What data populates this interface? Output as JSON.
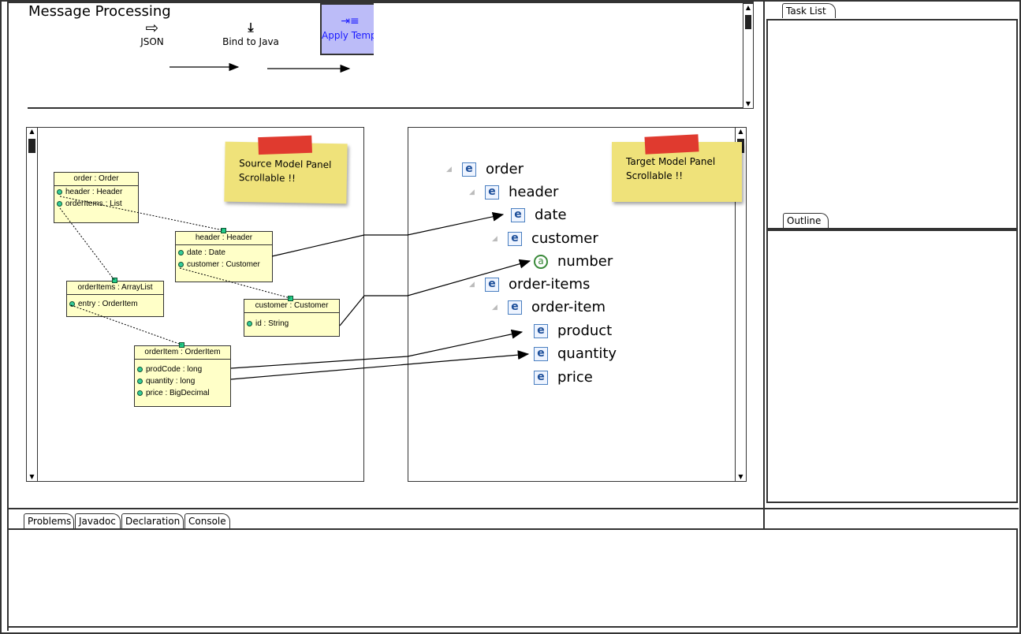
{
  "title": "Message Processing",
  "toolbar": {
    "steps": [
      {
        "label": "JSON",
        "icon": "arrow-right-outline-icon"
      },
      {
        "label": "Bind to Java",
        "icon": "download-icon"
      },
      {
        "label": "Apply Temp",
        "icon": "template-icon",
        "active": true
      }
    ],
    "active_color": "#bcbcf8"
  },
  "source_panel": {
    "note": [
      "Source Model Panel",
      "Scrollable !!"
    ],
    "classes": [
      {
        "title": "order : Order",
        "fields": [
          "header : Header",
          "orderItems : List"
        ]
      },
      {
        "title": "header : Header",
        "fields": [
          "date : Date",
          "customer : Customer"
        ]
      },
      {
        "title": "orderItems : ArrayList",
        "fields": [
          "entry : OrderItem"
        ]
      },
      {
        "title": "customer : Customer",
        "fields": [
          "id : String"
        ]
      },
      {
        "title": "orderItem : OrderItem",
        "fields": [
          "prodCode : long",
          "quantity : long",
          "price : BigDecimal"
        ]
      }
    ]
  },
  "target_panel": {
    "note": [
      "Target Model Panel",
      "Scrollable !!"
    ],
    "tree": [
      {
        "label": "order",
        "type": "e",
        "expanded": true
      },
      {
        "label": "header",
        "type": "e",
        "expanded": true
      },
      {
        "label": "date",
        "type": "e"
      },
      {
        "label": "customer",
        "type": "e",
        "expanded": true
      },
      {
        "label": "number",
        "type": "a"
      },
      {
        "label": "order-items",
        "type": "e",
        "expanded": true
      },
      {
        "label": "order-item",
        "type": "e",
        "expanded": true
      },
      {
        "label": "product",
        "type": "e"
      },
      {
        "label": "quantity",
        "type": "e"
      },
      {
        "label": "price",
        "type": "e"
      }
    ]
  },
  "right": {
    "task_list": "Task List",
    "outline": "Outline"
  },
  "bottom_tabs": [
    "Problems",
    "Javadoc",
    "Declaration",
    "Console"
  ]
}
